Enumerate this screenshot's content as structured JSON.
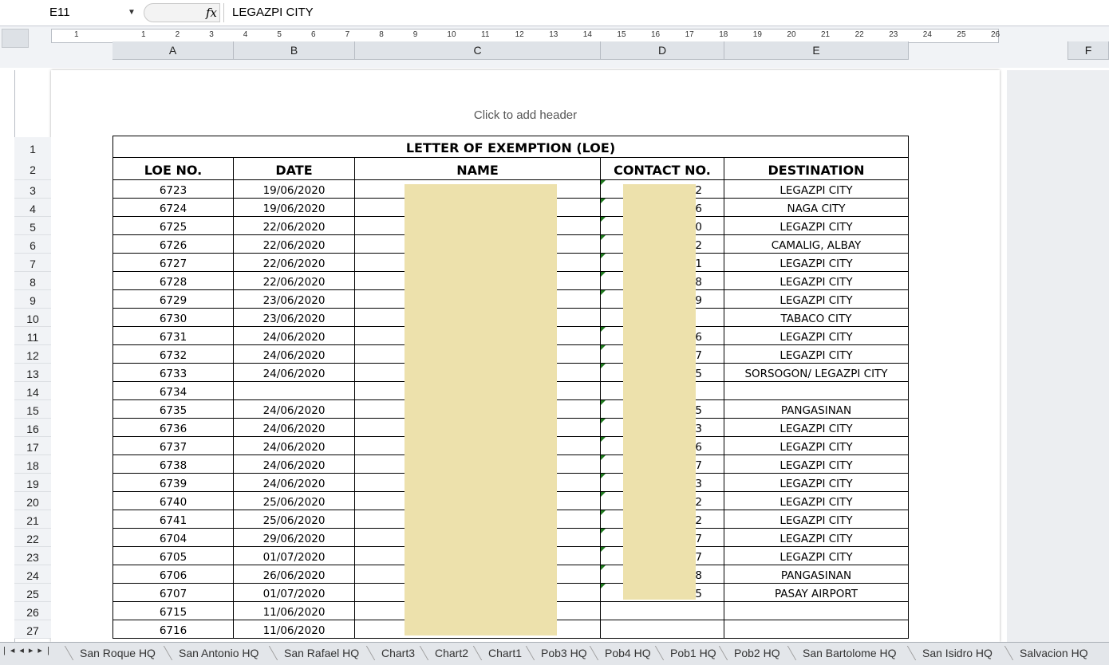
{
  "formula_bar": {
    "cell_ref": "E11",
    "fx": "fx",
    "value": "LEGAZPI CITY"
  },
  "ruler": {
    "ticks": [
      "1",
      "1",
      "2",
      "3",
      "4",
      "5",
      "6",
      "7",
      "8",
      "9",
      "10",
      "11",
      "12",
      "13",
      "14",
      "15",
      "16",
      "17",
      "18",
      "19",
      "20",
      "21",
      "22",
      "23",
      "24",
      "25",
      "26"
    ]
  },
  "columns": [
    "A",
    "B",
    "C",
    "D",
    "E",
    "F"
  ],
  "page_header_placeholder": "Click to add header",
  "table": {
    "title": "LETTER OF EXEMPTION (LOE)",
    "headers": [
      "LOE NO.",
      "DATE",
      "NAME",
      "CONTACT NO.",
      "DESTINATION"
    ],
    "rows": [
      {
        "row": "3",
        "loe": "6723",
        "date": "19/06/2020",
        "contact": "2",
        "dest": "LEGAZPI CITY",
        "flag": true
      },
      {
        "row": "4",
        "loe": "6724",
        "date": "19/06/2020",
        "contact": "6",
        "dest": "NAGA CITY",
        "flag": true
      },
      {
        "row": "5",
        "loe": "6725",
        "date": "22/06/2020",
        "contact": "0",
        "dest": "LEGAZPI CITY",
        "flag": true
      },
      {
        "row": "6",
        "loe": "6726",
        "date": "22/06/2020",
        "contact": "2",
        "dest": "CAMALIG, ALBAY",
        "flag": true
      },
      {
        "row": "7",
        "loe": "6727",
        "date": "22/06/2020",
        "contact": "1",
        "dest": "LEGAZPI CITY",
        "flag": true
      },
      {
        "row": "8",
        "loe": "6728",
        "date": "22/06/2020",
        "contact": "8",
        "dest": "LEGAZPI CITY",
        "flag": true
      },
      {
        "row": "9",
        "loe": "6729",
        "date": "23/06/2020",
        "contact": "9",
        "dest": "LEGAZPI CITY",
        "flag": true
      },
      {
        "row": "10",
        "loe": "6730",
        "date": "23/06/2020",
        "contact": "",
        "dest": "TABACO CITY",
        "flag": false
      },
      {
        "row": "11",
        "loe": "6731",
        "date": "24/06/2020",
        "contact": "6",
        "dest": "LEGAZPI CITY",
        "flag": true
      },
      {
        "row": "12",
        "loe": "6732",
        "date": "24/06/2020",
        "contact": "7",
        "dest": "LEGAZPI CITY",
        "flag": true
      },
      {
        "row": "13",
        "loe": "6733",
        "date": "24/06/2020",
        "contact": "5",
        "dest": "SORSOGON/ LEGAZPI CITY",
        "flag": true
      },
      {
        "row": "14",
        "loe": "6734",
        "date": "",
        "contact": "",
        "dest": "",
        "flag": false
      },
      {
        "row": "15",
        "loe": "6735",
        "date": "24/06/2020",
        "contact": "5",
        "dest": "PANGASINAN",
        "flag": true
      },
      {
        "row": "16",
        "loe": "6736",
        "date": "24/06/2020",
        "contact": "3",
        "dest": "LEGAZPI CITY",
        "flag": true
      },
      {
        "row": "17",
        "loe": "6737",
        "date": "24/06/2020",
        "contact": "6",
        "dest": "LEGAZPI CITY",
        "flag": true
      },
      {
        "row": "18",
        "loe": "6738",
        "date": "24/06/2020",
        "contact": "7",
        "dest": "LEGAZPI CITY",
        "flag": true
      },
      {
        "row": "19",
        "loe": "6739",
        "date": "24/06/2020",
        "contact": "3",
        "dest": "LEGAZPI CITY",
        "flag": true
      },
      {
        "row": "20",
        "loe": "6740",
        "date": "25/06/2020",
        "contact": "2",
        "dest": "LEGAZPI CITY",
        "flag": true
      },
      {
        "row": "21",
        "loe": "6741",
        "date": "25/06/2020",
        "contact": "2",
        "dest": "LEGAZPI  CITY",
        "flag": true
      },
      {
        "row": "22",
        "loe": "6704",
        "date": "29/06/2020",
        "contact": "7",
        "dest": "LEGAZPI CITY",
        "flag": true
      },
      {
        "row": "23",
        "loe": "6705",
        "date": "01/07/2020",
        "contact": "7",
        "dest": "LEGAZPI CITY",
        "flag": true
      },
      {
        "row": "24",
        "loe": "6706",
        "date": "26/06/2020",
        "contact": "8",
        "dest": "PANGASINAN",
        "flag": true
      },
      {
        "row": "25",
        "loe": "6707",
        "date": "01/07/2020",
        "contact": "5",
        "dest": "PASAY AIRPORT",
        "flag": true
      },
      {
        "row": "26",
        "loe": "6715",
        "date": "11/06/2020",
        "contact": "",
        "dest": "",
        "flag": false
      },
      {
        "row": "27",
        "loe": "6716",
        "date": "11/06/2020",
        "contact": "",
        "dest": "",
        "flag": false
      }
    ]
  },
  "sheet_tabs": [
    "San Roque HQ",
    "San Antonio HQ",
    "San Rafael HQ",
    "Chart3",
    "Chart2",
    "Chart1",
    "Pob3 HQ",
    "Pob4 HQ",
    "Pob1 HQ",
    "Pob2 HQ",
    "San Bartolome HQ",
    "San Isidro HQ",
    "Salvacion HQ"
  ],
  "colors": {
    "redaction": "#ede1ac",
    "flag": "#1e7a1e"
  }
}
